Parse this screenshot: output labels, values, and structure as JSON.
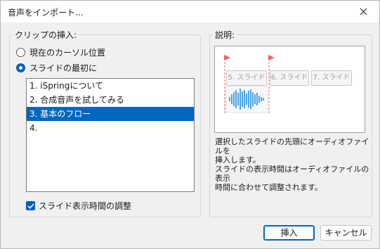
{
  "window": {
    "title": "音声をインポート..."
  },
  "insert_group": {
    "label": "クリップの挿入:",
    "options": [
      {
        "label": "現在のカーソル位置",
        "selected": false
      },
      {
        "label": "スライドの最初に",
        "selected": true
      }
    ],
    "slides": [
      {
        "label": "1. iSpringについて",
        "selected": false
      },
      {
        "label": "2. 合成音声を試してみる",
        "selected": false
      },
      {
        "label": "3. 基本のフロー",
        "selected": true
      },
      {
        "label": "4.",
        "selected": false
      }
    ],
    "adjust_checkbox": {
      "label": "スライド表示時間の調整",
      "checked": true
    }
  },
  "description_group": {
    "label": "説明:",
    "preview_slides": [
      "5. スライド",
      "6. スライド",
      "7. スライド"
    ],
    "text": [
      "選択したスライドの先頭にオーディオファイルを",
      "挿入します。",
      "スライドの表示時間はオーディオファイルの表示",
      "時間に合わせて調整されます。"
    ]
  },
  "buttons": {
    "insert": "挿入",
    "cancel": "キャンセル"
  },
  "colors": {
    "accent": "#0067c0",
    "marker": "#f0605a",
    "waveform": "#4ca3e6"
  }
}
